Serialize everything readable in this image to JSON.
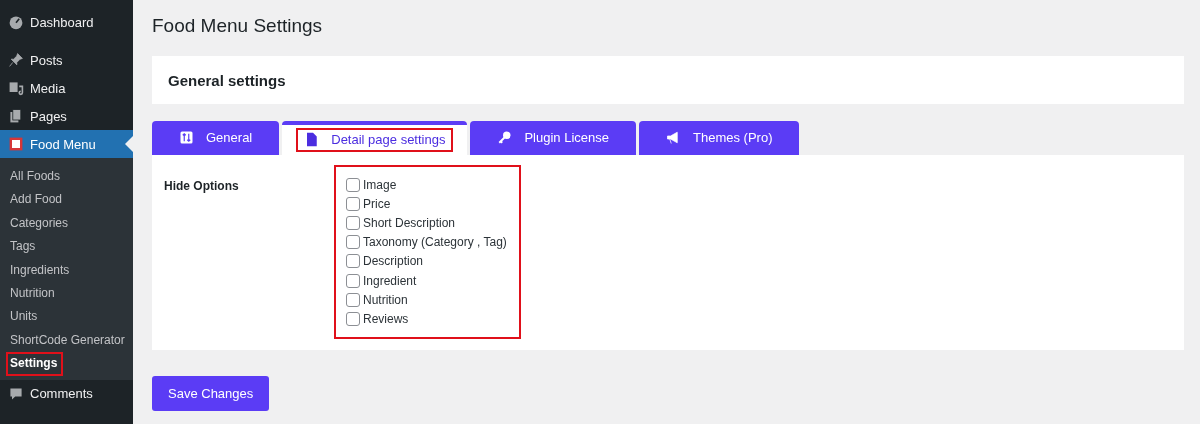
{
  "sidebar": {
    "items": [
      {
        "label": "Dashboard",
        "selected": false
      },
      {
        "label": "Posts",
        "selected": false
      },
      {
        "label": "Media",
        "selected": false
      },
      {
        "label": "Pages",
        "selected": false
      },
      {
        "label": "Food Menu",
        "selected": true,
        "children": [
          {
            "label": "All Foods",
            "selected": false,
            "highlighted": false
          },
          {
            "label": "Add Food",
            "selected": false,
            "highlighted": false
          },
          {
            "label": "Categories",
            "selected": false,
            "highlighted": false
          },
          {
            "label": "Tags",
            "selected": false,
            "highlighted": false
          },
          {
            "label": "Ingredients",
            "selected": false,
            "highlighted": false
          },
          {
            "label": "Nutrition",
            "selected": false,
            "highlighted": false
          },
          {
            "label": "Units",
            "selected": false,
            "highlighted": false
          },
          {
            "label": "ShortCode Generator",
            "selected": false,
            "highlighted": false
          },
          {
            "label": "Settings",
            "selected": true,
            "highlighted": true
          }
        ]
      },
      {
        "label": "Comments",
        "selected": false
      }
    ]
  },
  "page_title": "Food Menu Settings",
  "section_title": "General settings",
  "tabs": [
    {
      "label": "General",
      "selected": false,
      "highlighted": false
    },
    {
      "label": "Detail page settings",
      "selected": true,
      "highlighted": true
    },
    {
      "label": "Plugin License",
      "selected": false,
      "highlighted": false
    },
    {
      "label": "Themes (Pro)",
      "selected": false,
      "highlighted": false
    }
  ],
  "hide_options": {
    "label": "Hide Options",
    "highlighted": true,
    "options": [
      {
        "label": "Image",
        "checked": false
      },
      {
        "label": "Price",
        "checked": false
      },
      {
        "label": "Short Description",
        "checked": false
      },
      {
        "label": "Taxonomy (Category , Tag)",
        "checked": false
      },
      {
        "label": "Description",
        "checked": false
      },
      {
        "label": "Ingredient",
        "checked": false
      },
      {
        "label": "Nutrition",
        "checked": false
      },
      {
        "label": "Reviews",
        "checked": false
      }
    ]
  },
  "save_button": "Save Changes"
}
